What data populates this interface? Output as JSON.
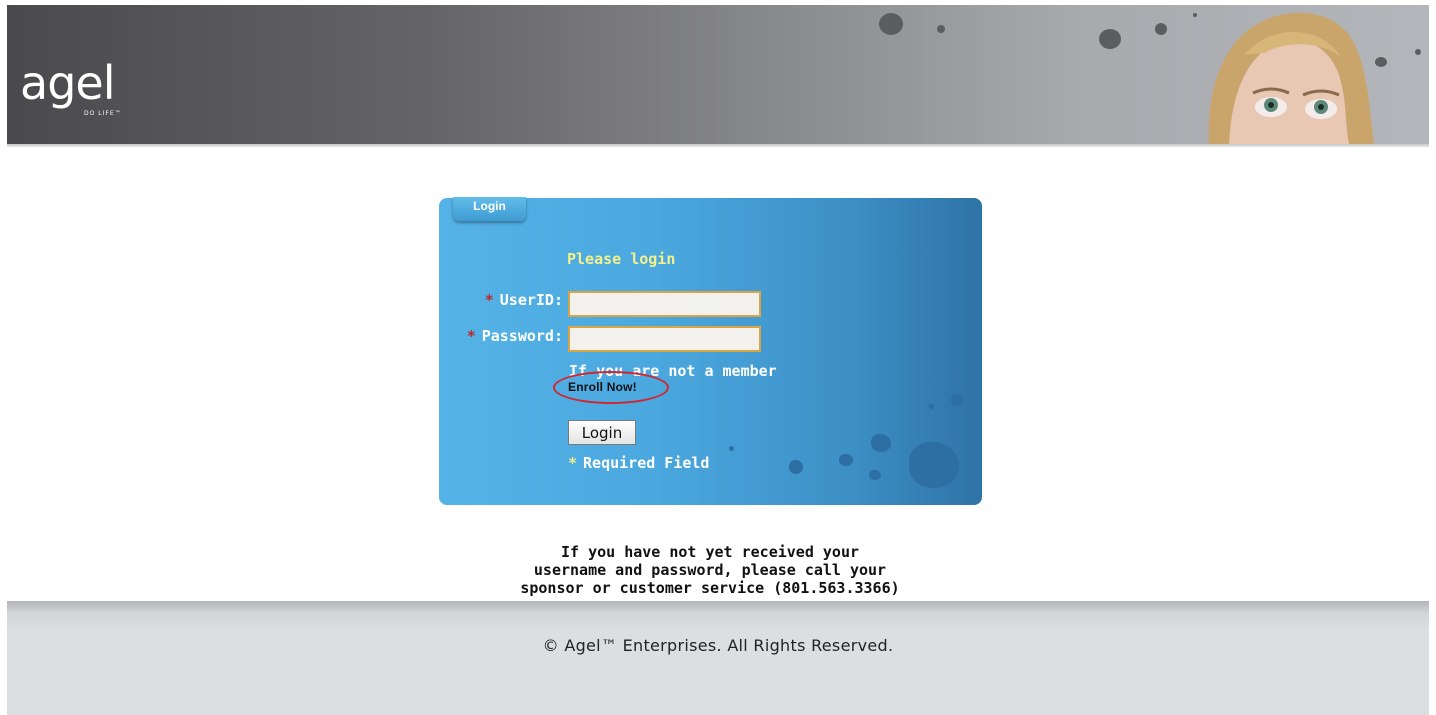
{
  "brand": {
    "logo_text": "agel",
    "tagline": "DO LIFE™",
    "header_colors": [
      "#4a4a4c",
      "#b3b6ba"
    ]
  },
  "login": {
    "tab_label": "Login",
    "prompt": "Please login",
    "required_star": "*",
    "userid_label": "UserID:",
    "password_label": "Password:",
    "userid_value": "",
    "password_value": "",
    "not_member_text": "If you are not a member",
    "enroll_link": "Enroll Now!",
    "submit_label": "Login",
    "required_note": "Required Field",
    "accent_color": "#f4f08a",
    "field_border_color": "#d9a441"
  },
  "help": {
    "line1": "If you have not yet received your",
    "line2": "username and password, please call your",
    "line3": "sponsor or customer service (801.563.3366)"
  },
  "footer": {
    "copyright": "© Agel™ Enterprises. All Rights Reserved."
  }
}
